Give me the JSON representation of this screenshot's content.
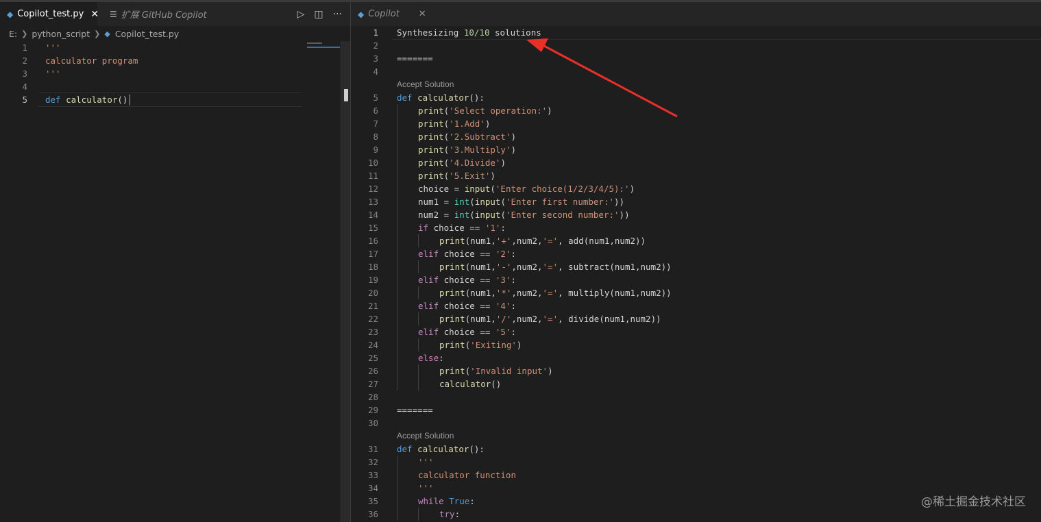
{
  "left_editor": {
    "tabs": [
      {
        "label": "Copilot_test.py",
        "active": true,
        "icon": "python-file-icon"
      },
      {
        "label": "扩展 GitHub Copilot",
        "active": false,
        "icon": "extension-preview-icon"
      }
    ],
    "breadcrumb": [
      "E:",
      "python_script",
      "Copilot_test.py"
    ],
    "lines": [
      {
        "n": "1",
        "tokens": [
          {
            "t": "'''",
            "c": "str"
          }
        ]
      },
      {
        "n": "2",
        "tokens": [
          {
            "t": "calculator program",
            "c": "str"
          }
        ]
      },
      {
        "n": "3",
        "tokens": [
          {
            "t": "'''",
            "c": "str"
          }
        ]
      },
      {
        "n": "4",
        "tokens": []
      },
      {
        "n": "5",
        "tokens": [
          {
            "t": "def ",
            "c": "kw"
          },
          {
            "t": "calculator",
            "c": "fn"
          },
          {
            "t": "()",
            "c": "plain"
          }
        ],
        "current": true
      }
    ]
  },
  "right_editor": {
    "tab": {
      "label": "Copilot",
      "icon": "python-file-icon"
    },
    "lines": [
      {
        "n": "1",
        "tokens": [
          {
            "t": "Synthesizing ",
            "c": "plain"
          },
          {
            "t": "10/10",
            "c": "num"
          },
          {
            "t": " solutions",
            "c": "plain"
          }
        ],
        "current": true
      },
      {
        "n": "2",
        "tokens": []
      },
      {
        "n": "3",
        "tokens": [
          {
            "t": "=======",
            "c": "plain"
          }
        ]
      },
      {
        "n": "4",
        "tokens": []
      },
      {
        "accept": "Accept Solution"
      },
      {
        "n": "5",
        "tokens": [
          {
            "t": "def ",
            "c": "kw"
          },
          {
            "t": "calculator",
            "c": "fn"
          },
          {
            "t": "():",
            "c": "plain"
          }
        ]
      },
      {
        "n": "6",
        "indent": 1,
        "tokens": [
          {
            "t": "print",
            "c": "fn"
          },
          {
            "t": "(",
            "c": "plain"
          },
          {
            "t": "'Select operation:'",
            "c": "str"
          },
          {
            "t": ")",
            "c": "plain"
          }
        ]
      },
      {
        "n": "7",
        "indent": 1,
        "tokens": [
          {
            "t": "print",
            "c": "fn"
          },
          {
            "t": "(",
            "c": "plain"
          },
          {
            "t": "'1.Add'",
            "c": "str"
          },
          {
            "t": ")",
            "c": "plain"
          }
        ]
      },
      {
        "n": "8",
        "indent": 1,
        "tokens": [
          {
            "t": "print",
            "c": "fn"
          },
          {
            "t": "(",
            "c": "plain"
          },
          {
            "t": "'2.Subtract'",
            "c": "str"
          },
          {
            "t": ")",
            "c": "plain"
          }
        ]
      },
      {
        "n": "9",
        "indent": 1,
        "tokens": [
          {
            "t": "print",
            "c": "fn"
          },
          {
            "t": "(",
            "c": "plain"
          },
          {
            "t": "'3.Multiply'",
            "c": "str"
          },
          {
            "t": ")",
            "c": "plain"
          }
        ]
      },
      {
        "n": "10",
        "indent": 1,
        "tokens": [
          {
            "t": "print",
            "c": "fn"
          },
          {
            "t": "(",
            "c": "plain"
          },
          {
            "t": "'4.Divide'",
            "c": "str"
          },
          {
            "t": ")",
            "c": "plain"
          }
        ]
      },
      {
        "n": "11",
        "indent": 1,
        "tokens": [
          {
            "t": "print",
            "c": "fn"
          },
          {
            "t": "(",
            "c": "plain"
          },
          {
            "t": "'5.Exit'",
            "c": "str"
          },
          {
            "t": ")",
            "c": "plain"
          }
        ]
      },
      {
        "n": "12",
        "indent": 1,
        "tokens": [
          {
            "t": "choice = ",
            "c": "plain"
          },
          {
            "t": "input",
            "c": "fn"
          },
          {
            "t": "(",
            "c": "plain"
          },
          {
            "t": "'Enter choice(1/2/3/4/5):'",
            "c": "str"
          },
          {
            "t": ")",
            "c": "plain"
          }
        ]
      },
      {
        "n": "13",
        "indent": 1,
        "tokens": [
          {
            "t": "num1 = ",
            "c": "plain"
          },
          {
            "t": "int",
            "c": "bi"
          },
          {
            "t": "(",
            "c": "plain"
          },
          {
            "t": "input",
            "c": "fn"
          },
          {
            "t": "(",
            "c": "plain"
          },
          {
            "t": "'Enter first number:'",
            "c": "str"
          },
          {
            "t": "))",
            "c": "plain"
          }
        ]
      },
      {
        "n": "14",
        "indent": 1,
        "tokens": [
          {
            "t": "num2 = ",
            "c": "plain"
          },
          {
            "t": "int",
            "c": "bi"
          },
          {
            "t": "(",
            "c": "plain"
          },
          {
            "t": "input",
            "c": "fn"
          },
          {
            "t": "(",
            "c": "plain"
          },
          {
            "t": "'Enter second number:'",
            "c": "str"
          },
          {
            "t": "))",
            "c": "plain"
          }
        ]
      },
      {
        "n": "15",
        "indent": 1,
        "tokens": [
          {
            "t": "if ",
            "c": "kwc"
          },
          {
            "t": "choice == ",
            "c": "plain"
          },
          {
            "t": "'1'",
            "c": "str"
          },
          {
            "t": ":",
            "c": "plain"
          }
        ]
      },
      {
        "n": "16",
        "indent": 2,
        "tokens": [
          {
            "t": "print",
            "c": "fn"
          },
          {
            "t": "(num1,",
            "c": "plain"
          },
          {
            "t": "'+'",
            "c": "str"
          },
          {
            "t": ",num2,",
            "c": "plain"
          },
          {
            "t": "'='",
            "c": "str"
          },
          {
            "t": ", add(num1,num2))",
            "c": "plain"
          }
        ]
      },
      {
        "n": "17",
        "indent": 1,
        "tokens": [
          {
            "t": "elif ",
            "c": "kwc"
          },
          {
            "t": "choice == ",
            "c": "plain"
          },
          {
            "t": "'2'",
            "c": "str"
          },
          {
            "t": ":",
            "c": "plain"
          }
        ]
      },
      {
        "n": "18",
        "indent": 2,
        "tokens": [
          {
            "t": "print",
            "c": "fn"
          },
          {
            "t": "(num1,",
            "c": "plain"
          },
          {
            "t": "'-'",
            "c": "str"
          },
          {
            "t": ",num2,",
            "c": "plain"
          },
          {
            "t": "'='",
            "c": "str"
          },
          {
            "t": ", subtract(num1,num2))",
            "c": "plain"
          }
        ]
      },
      {
        "n": "19",
        "indent": 1,
        "tokens": [
          {
            "t": "elif ",
            "c": "kwc"
          },
          {
            "t": "choice == ",
            "c": "plain"
          },
          {
            "t": "'3'",
            "c": "str"
          },
          {
            "t": ":",
            "c": "plain"
          }
        ]
      },
      {
        "n": "20",
        "indent": 2,
        "tokens": [
          {
            "t": "print",
            "c": "fn"
          },
          {
            "t": "(num1,",
            "c": "plain"
          },
          {
            "t": "'*'",
            "c": "str"
          },
          {
            "t": ",num2,",
            "c": "plain"
          },
          {
            "t": "'='",
            "c": "str"
          },
          {
            "t": ", multiply(num1,num2))",
            "c": "plain"
          }
        ]
      },
      {
        "n": "21",
        "indent": 1,
        "tokens": [
          {
            "t": "elif ",
            "c": "kwc"
          },
          {
            "t": "choice == ",
            "c": "plain"
          },
          {
            "t": "'4'",
            "c": "str"
          },
          {
            "t": ":",
            "c": "plain"
          }
        ]
      },
      {
        "n": "22",
        "indent": 2,
        "tokens": [
          {
            "t": "print",
            "c": "fn"
          },
          {
            "t": "(num1,",
            "c": "plain"
          },
          {
            "t": "'/'",
            "c": "str"
          },
          {
            "t": ",num2,",
            "c": "plain"
          },
          {
            "t": "'='",
            "c": "str"
          },
          {
            "t": ", divide(num1,num2))",
            "c": "plain"
          }
        ]
      },
      {
        "n": "23",
        "indent": 1,
        "tokens": [
          {
            "t": "elif ",
            "c": "kwc"
          },
          {
            "t": "choice == ",
            "c": "plain"
          },
          {
            "t": "'5'",
            "c": "str"
          },
          {
            "t": ":",
            "c": "plain"
          }
        ]
      },
      {
        "n": "24",
        "indent": 2,
        "tokens": [
          {
            "t": "print",
            "c": "fn"
          },
          {
            "t": "(",
            "c": "plain"
          },
          {
            "t": "'Exiting'",
            "c": "str"
          },
          {
            "t": ")",
            "c": "plain"
          }
        ]
      },
      {
        "n": "25",
        "indent": 1,
        "tokens": [
          {
            "t": "else",
            "c": "kwc"
          },
          {
            "t": ":",
            "c": "plain"
          }
        ]
      },
      {
        "n": "26",
        "indent": 2,
        "tokens": [
          {
            "t": "print",
            "c": "fn"
          },
          {
            "t": "(",
            "c": "plain"
          },
          {
            "t": "'Invalid input'",
            "c": "str"
          },
          {
            "t": ")",
            "c": "plain"
          }
        ]
      },
      {
        "n": "27",
        "indent": 2,
        "tokens": [
          {
            "t": "calculator",
            "c": "fn"
          },
          {
            "t": "()",
            "c": "plain"
          }
        ]
      },
      {
        "n": "28",
        "tokens": []
      },
      {
        "n": "29",
        "tokens": [
          {
            "t": "=======",
            "c": "plain"
          }
        ]
      },
      {
        "n": "30",
        "tokens": []
      },
      {
        "accept": "Accept Solution"
      },
      {
        "n": "31",
        "tokens": [
          {
            "t": "def ",
            "c": "kw"
          },
          {
            "t": "calculator",
            "c": "fn"
          },
          {
            "t": "():",
            "c": "plain"
          }
        ]
      },
      {
        "n": "32",
        "indent": 1,
        "tokens": [
          {
            "t": "'''",
            "c": "str"
          }
        ]
      },
      {
        "n": "33",
        "indent": 1,
        "tokens": [
          {
            "t": "calculator function",
            "c": "str"
          }
        ]
      },
      {
        "n": "34",
        "indent": 1,
        "tokens": [
          {
            "t": "'''",
            "c": "str"
          }
        ]
      },
      {
        "n": "35",
        "indent": 1,
        "tokens": [
          {
            "t": "while ",
            "c": "kwc"
          },
          {
            "t": "True",
            "c": "kw"
          },
          {
            "t": ":",
            "c": "plain"
          }
        ]
      },
      {
        "n": "36",
        "indent": 2,
        "tokens": [
          {
            "t": "try",
            "c": "kwc"
          },
          {
            "t": ":",
            "c": "plain"
          }
        ]
      }
    ]
  },
  "watermark": "@稀土掘金技术社区",
  "colors": {
    "arrow": "#e8302a",
    "keyword": "#569cd6",
    "control": "#c586c0",
    "function": "#dcdcaa",
    "string": "#ce9178",
    "number": "#b5cea8"
  }
}
